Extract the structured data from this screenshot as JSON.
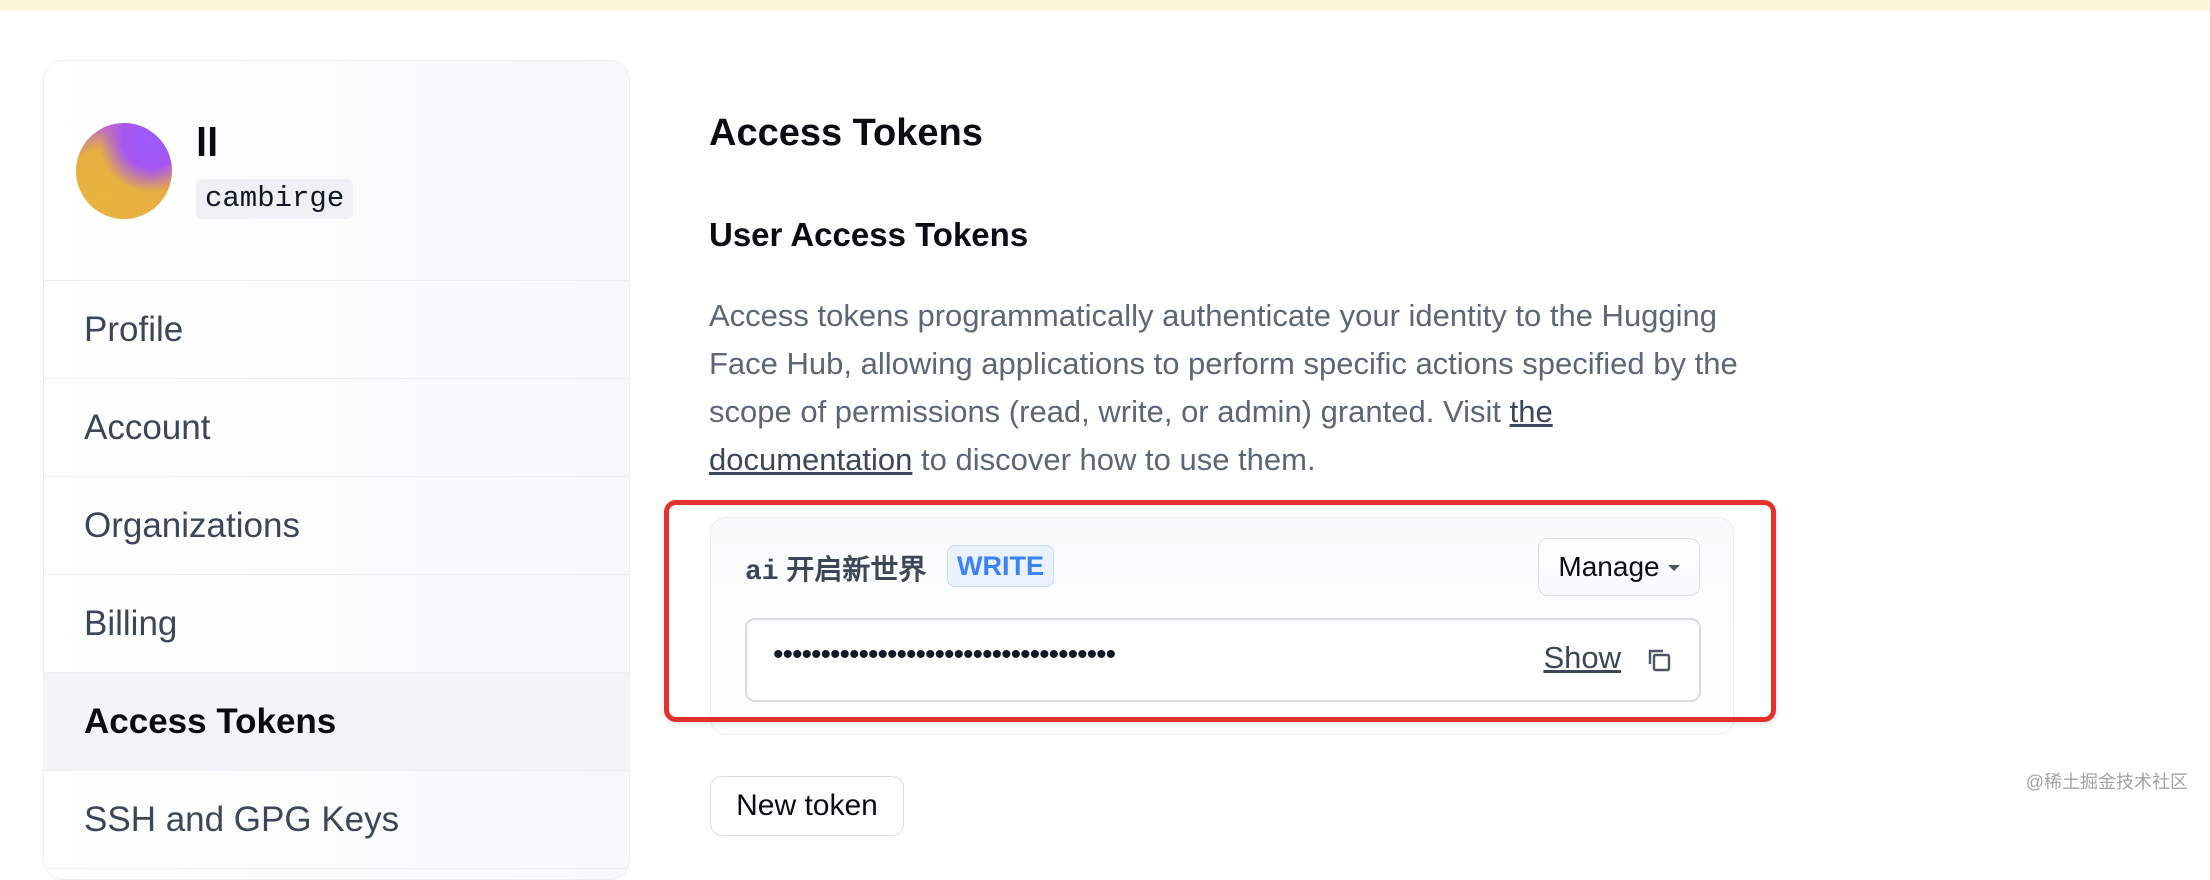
{
  "user": {
    "display_name": "ll",
    "username": "cambirge"
  },
  "sidebar": {
    "items": [
      {
        "label": "Profile",
        "active": false
      },
      {
        "label": "Account",
        "active": false
      },
      {
        "label": "Organizations",
        "active": false
      },
      {
        "label": "Billing",
        "active": false
      },
      {
        "label": "Access Tokens",
        "active": true
      },
      {
        "label": "SSH and GPG Keys",
        "active": false
      }
    ]
  },
  "main": {
    "title": "Access Tokens",
    "section_title": "User Access Tokens",
    "description": {
      "text_before": "Access tokens programmatically authenticate your identity to the Hugging Face Hub, allowing applications to perform specific actions specified by the scope of permissions (read, write, or admin) granted. Visit ",
      "link_text": "the documentation",
      "text_after": " to discover how to use them."
    },
    "token": {
      "name_prefix": "ai",
      "name_suffix": "开启新世界",
      "role": "WRITE",
      "manage_label": "Manage",
      "masked_value": "••••••••••••••••••••••••••••••••••••",
      "show_label": "Show"
    },
    "new_token_label": "New token"
  },
  "watermark": "@稀土掘金技术社区",
  "colors": {
    "highlight_border": "#e4322b",
    "badge_text": "#3b82f6",
    "banner": "#fdf6d8"
  }
}
